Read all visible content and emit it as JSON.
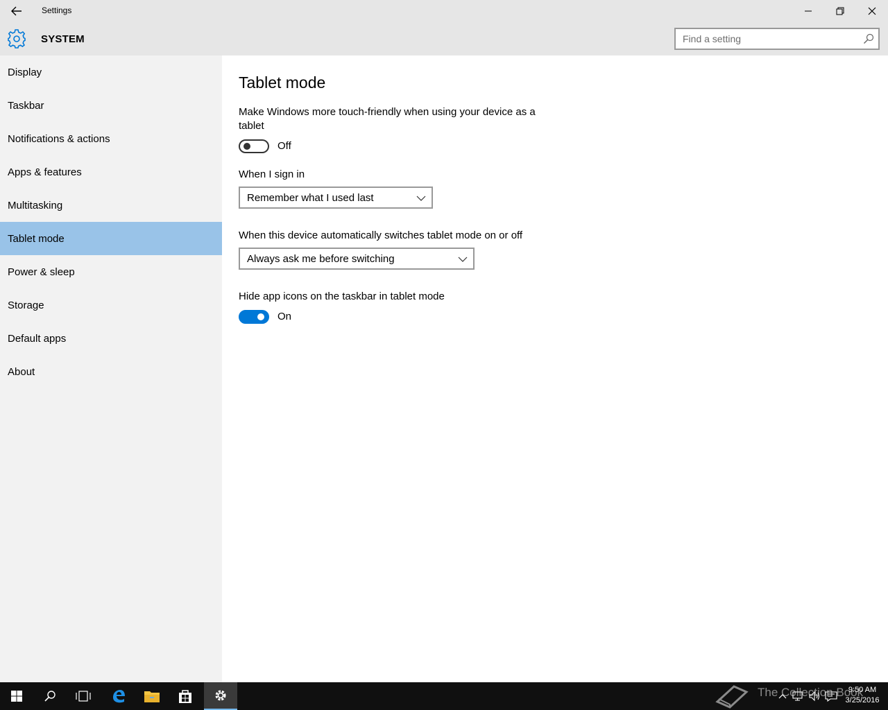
{
  "window": {
    "title": "Settings"
  },
  "header": {
    "section": "SYSTEM",
    "search_placeholder": "Find a setting"
  },
  "sidebar": {
    "items": [
      {
        "label": "Display"
      },
      {
        "label": "Taskbar"
      },
      {
        "label": "Notifications & actions"
      },
      {
        "label": "Apps & features"
      },
      {
        "label": "Multitasking"
      },
      {
        "label": "Tablet mode",
        "selected": true
      },
      {
        "label": "Power & sleep"
      },
      {
        "label": "Storage"
      },
      {
        "label": "Default apps"
      },
      {
        "label": "About"
      }
    ]
  },
  "main": {
    "title": "Tablet mode",
    "touch_friendly": {
      "description": "Make Windows more touch-friendly when using your device as a tablet",
      "state": "Off"
    },
    "sign_in": {
      "label": "When I sign in",
      "value": "Remember what I used last"
    },
    "auto_switch": {
      "label": "When this device automatically switches tablet mode on or off",
      "value": "Always ask me before switching"
    },
    "hide_icons": {
      "label": "Hide app icons on the taskbar in tablet mode",
      "state": "On"
    }
  },
  "taskbar": {
    "watermark": "The Collection Book",
    "time": "9:50 AM",
    "date": "3/25/2016"
  },
  "colors": {
    "accent": "#0078d7",
    "selected_nav": "#99c3e8",
    "sidebar_bg": "#f2f2f2",
    "chrome_bg": "#e6e6e6",
    "taskbar_bg": "#101010"
  }
}
